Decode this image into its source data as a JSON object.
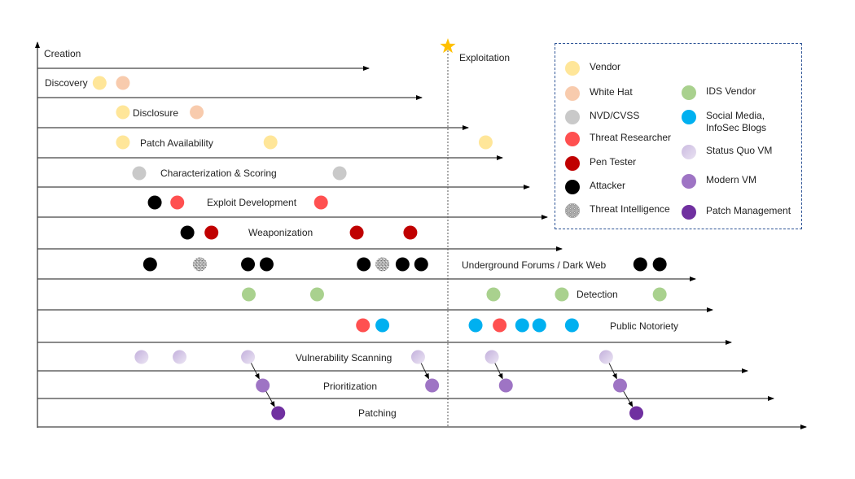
{
  "diagram": {
    "stages": [
      {
        "label": "Creation"
      },
      {
        "label": "Discovery"
      },
      {
        "label": "Disclosure"
      },
      {
        "label": "Patch Availability"
      },
      {
        "label": "Characterization & Scoring"
      },
      {
        "label": "Exploit Development"
      },
      {
        "label": "Weaponization"
      },
      {
        "label": "Underground Forums / Dark Web"
      },
      {
        "label": "Detection"
      },
      {
        "label": "Public Notoriety"
      },
      {
        "label": "Vulnerability Scanning"
      },
      {
        "label": "Prioritization"
      },
      {
        "label": "Patching"
      }
    ],
    "exploitation_marker": {
      "label": "Exploitation",
      "icon": "star-icon",
      "color": "#FFC000"
    }
  },
  "legend": {
    "items": [
      {
        "key": "vendor",
        "label": "Vendor",
        "color": "#FFE699"
      },
      {
        "key": "whitehat",
        "label": "White Hat",
        "color": "#F8CBAD"
      },
      {
        "key": "nvd",
        "label": "NVD/CVSS",
        "color": "#C9C9C9"
      },
      {
        "key": "threatresearcher",
        "label": "Threat Researcher",
        "color": "#FF5050"
      },
      {
        "key": "pentester",
        "label": "Pen Tester",
        "color": "#C00000"
      },
      {
        "key": "attacker",
        "label": "Attacker",
        "color": "#000000"
      },
      {
        "key": "threatintel",
        "label": "Threat Intelligence",
        "color": "#A6A6A6"
      },
      {
        "key": "idsvendor",
        "label": "IDS Vendor",
        "color": "#A9D18E"
      },
      {
        "key": "social",
        "label": "Social Media,\nInfoSec Blogs",
        "color": "#00B0F0"
      },
      {
        "key": "statusquo",
        "label": "Status Quo VM",
        "color": "#D9CCEA"
      },
      {
        "key": "modernvm",
        "label": "Modern VM",
        "color": "#9E74C4"
      },
      {
        "key": "patchmgmt",
        "label": "Patch Management",
        "color": "#7030A0"
      }
    ]
  },
  "events": [
    {
      "row": 1,
      "actor": "vendor",
      "t": 0.08
    },
    {
      "row": 1,
      "actor": "whitehat",
      "t": 0.11
    },
    {
      "row": 2,
      "actor": "vendor",
      "t": 0.11
    },
    {
      "row": 2,
      "actor": "whitehat",
      "t": 0.205
    },
    {
      "row": 3,
      "actor": "vendor",
      "t": 0.11
    },
    {
      "row": 3,
      "actor": "vendor",
      "t": 0.3
    },
    {
      "row": 3,
      "actor": "vendor",
      "t": 0.577
    },
    {
      "row": 4,
      "actor": "nvd",
      "t": 0.131
    },
    {
      "row": 4,
      "actor": "nvd",
      "t": 0.389
    },
    {
      "row": 5,
      "actor": "attacker",
      "t": 0.151
    },
    {
      "row": 5,
      "actor": "threatresearcher",
      "t": 0.18
    },
    {
      "row": 5,
      "actor": "threatresearcher",
      "t": 0.365
    },
    {
      "row": 6,
      "actor": "attacker",
      "t": 0.193
    },
    {
      "row": 6,
      "actor": "pentester",
      "t": 0.224
    },
    {
      "row": 6,
      "actor": "pentester",
      "t": 0.411
    },
    {
      "row": 6,
      "actor": "pentester",
      "t": 0.48
    },
    {
      "row": 7,
      "actor": "attacker",
      "t": 0.145
    },
    {
      "row": 7,
      "actor": "threatintel",
      "t": 0.209
    },
    {
      "row": 7,
      "actor": "attacker",
      "t": 0.271
    },
    {
      "row": 7,
      "actor": "attacker",
      "t": 0.295
    },
    {
      "row": 7,
      "actor": "attacker",
      "t": 0.42
    },
    {
      "row": 7,
      "actor": "threatintel",
      "t": 0.444
    },
    {
      "row": 7,
      "actor": "attacker",
      "t": 0.47
    },
    {
      "row": 7,
      "actor": "attacker",
      "t": 0.494
    },
    {
      "row": 7,
      "actor": "attacker",
      "t": 0.776
    },
    {
      "row": 7,
      "actor": "attacker",
      "t": 0.801
    },
    {
      "row": 8,
      "actor": "idsvendor",
      "t": 0.272
    },
    {
      "row": 8,
      "actor": "idsvendor",
      "t": 0.36
    },
    {
      "row": 8,
      "actor": "idsvendor",
      "t": 0.587
    },
    {
      "row": 8,
      "actor": "idsvendor",
      "t": 0.675
    },
    {
      "row": 8,
      "actor": "idsvendor",
      "t": 0.801
    },
    {
      "row": 9,
      "actor": "threatresearcher",
      "t": 0.419
    },
    {
      "row": 9,
      "actor": "social",
      "t": 0.444
    },
    {
      "row": 9,
      "actor": "social",
      "t": 0.564
    },
    {
      "row": 9,
      "actor": "threatresearcher",
      "t": 0.595
    },
    {
      "row": 9,
      "actor": "social",
      "t": 0.624
    },
    {
      "row": 9,
      "actor": "social",
      "t": 0.646
    },
    {
      "row": 9,
      "actor": "social",
      "t": 0.688
    },
    {
      "row": 10,
      "actor": "statusquo",
      "t": 0.134
    },
    {
      "row": 10,
      "actor": "statusquo",
      "t": 0.183
    },
    {
      "row": 10,
      "actor": "statusquo",
      "t": 0.271
    },
    {
      "row": 10,
      "actor": "statusquo",
      "t": 0.49
    },
    {
      "row": 10,
      "actor": "statusquo",
      "t": 0.585
    },
    {
      "row": 10,
      "actor": "statusquo",
      "t": 0.732
    },
    {
      "row": 11,
      "actor": "modernvm",
      "t": 0.29
    },
    {
      "row": 11,
      "actor": "modernvm",
      "t": 0.508
    },
    {
      "row": 11,
      "actor": "modernvm",
      "t": 0.603
    },
    {
      "row": 11,
      "actor": "modernvm",
      "t": 0.75
    },
    {
      "row": 12,
      "actor": "patchmgmt",
      "t": 0.31
    },
    {
      "row": 12,
      "actor": "patchmgmt",
      "t": 0.771
    }
  ],
  "flows": [
    {
      "from": [
        10,
        0.271
      ],
      "to": [
        11,
        0.29
      ]
    },
    {
      "from": [
        11,
        0.29
      ],
      "to": [
        12,
        0.31
      ]
    },
    {
      "from": [
        10,
        0.49
      ],
      "to": [
        11,
        0.508
      ]
    },
    {
      "from": [
        10,
        0.585
      ],
      "to": [
        11,
        0.603
      ]
    },
    {
      "from": [
        10,
        0.732
      ],
      "to": [
        11,
        0.75
      ]
    },
    {
      "from": [
        11,
        0.75
      ],
      "to": [
        12,
        0.771
      ]
    }
  ]
}
